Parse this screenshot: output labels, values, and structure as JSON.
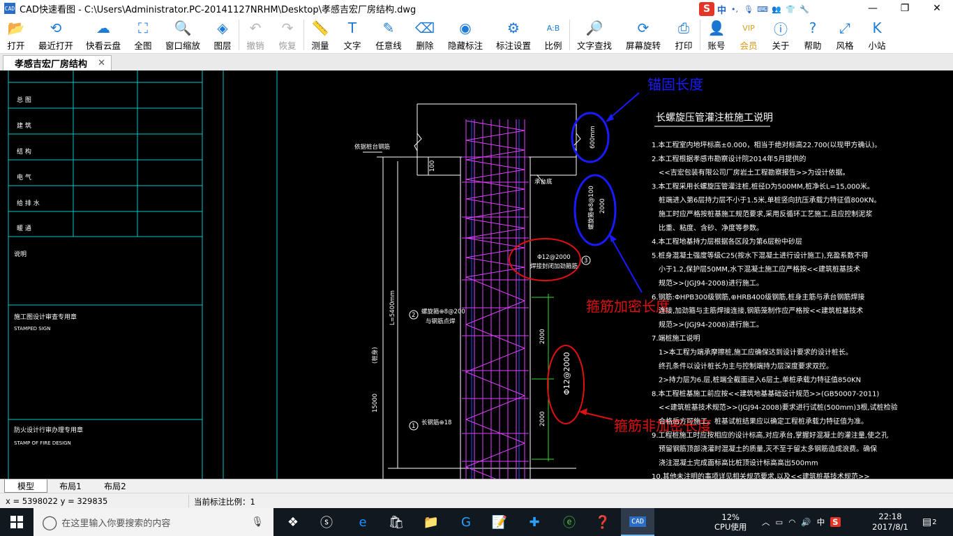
{
  "window": {
    "title": "CAD快速看图 - C:\\Users\\Administrator.PC-20141127NRHM\\Desktop\\孝感吉宏厂房结构.dwg",
    "app_icon": "CAD"
  },
  "ime": {
    "logo": "S",
    "lang": "中",
    "punct": "•,"
  },
  "window_controls": {
    "minimize": "—",
    "maximize": "❐",
    "close": "✕"
  },
  "toolbar": [
    {
      "label": "打开",
      "icon": "folder-open-icon",
      "glyph": "📂",
      "disabled": false
    },
    {
      "label": "最近打开",
      "icon": "history-icon",
      "glyph": "⟲",
      "disabled": false
    },
    {
      "label": "快看云盘",
      "icon": "cloud-icon",
      "glyph": "☁",
      "disabled": false
    },
    {
      "label": "全图",
      "icon": "fit-all-icon",
      "glyph": "⛶",
      "disabled": false
    },
    {
      "label": "窗口缩放",
      "icon": "zoom-window-icon",
      "glyph": "🔍",
      "disabled": false
    },
    {
      "label": "图层",
      "icon": "layers-icon",
      "glyph": "◈",
      "disabled": false
    },
    {
      "label": "撤销",
      "icon": "undo-icon",
      "glyph": "↶",
      "disabled": true
    },
    {
      "label": "恢复",
      "icon": "redo-icon",
      "glyph": "↷",
      "disabled": true
    },
    {
      "label": "测量",
      "icon": "ruler-icon",
      "glyph": "📏",
      "disabled": false
    },
    {
      "label": "文字",
      "icon": "text-icon",
      "glyph": "T",
      "disabled": false
    },
    {
      "label": "任意线",
      "icon": "pencil-icon",
      "glyph": "✎",
      "disabled": false
    },
    {
      "label": "删除",
      "icon": "eraser-icon",
      "glyph": "⌫",
      "disabled": false
    },
    {
      "label": "隐藏标注",
      "icon": "eye-hide-icon",
      "glyph": "◉",
      "disabled": false
    },
    {
      "label": "标注设置",
      "icon": "settings-icon",
      "glyph": "⚙",
      "disabled": false
    },
    {
      "label": "比例",
      "icon": "scale-icon",
      "glyph": "A:B",
      "disabled": false
    },
    {
      "label": "文字查找",
      "icon": "text-search-icon",
      "glyph": "🔎",
      "disabled": false
    },
    {
      "label": "屏幕旋转",
      "icon": "rotate-icon",
      "glyph": "⟳",
      "disabled": false
    },
    {
      "label": "打印",
      "icon": "printer-icon",
      "glyph": "⎙",
      "disabled": false
    },
    {
      "label": "账号",
      "icon": "user-icon",
      "glyph": "👤",
      "disabled": false
    },
    {
      "label": "会员",
      "icon": "vip-icon",
      "glyph": "VIP",
      "disabled": false
    },
    {
      "label": "关于",
      "icon": "info-icon",
      "glyph": "ⓘ",
      "disabled": false
    },
    {
      "label": "帮助",
      "icon": "help-icon",
      "glyph": "?",
      "disabled": false
    },
    {
      "label": "风格",
      "icon": "style-icon",
      "glyph": "⤢",
      "disabled": false
    },
    {
      "label": "小站",
      "icon": "site-icon",
      "glyph": "K",
      "disabled": false
    }
  ],
  "doc_tab": {
    "label": "孝感吉宏厂房结构",
    "close": "✕"
  },
  "drawing": {
    "title_block": {
      "rows": [
        "总  图",
        "建  筑",
        "结  构",
        "电  气",
        "给 排 水",
        "暖  通"
      ],
      "note_label": "说明",
      "stamp_cn": "施工图设计审查专用章",
      "stamp_en": "STAMPED SIGN",
      "fire_cn": "防火设计行审办理专用章",
      "fire_en": "STAMP OF FIRE DESIGN"
    },
    "annotations": {
      "anchor": "锚固长度",
      "dense": "箍筋加密长度",
      "non_dense": "箍筋非加密长度"
    },
    "section_labels": {
      "pile_top": "依据桩台钢筋",
      "cap_bottom": "承台底",
      "dim_600": "600mm",
      "dim_100": "100",
      "spiral_dense": "螺旋箍⊕8@100",
      "dim_2000a": "2000",
      "ring_bar": "Φ12@2000",
      "ring_desc": "焊接封闭加劲箍筋",
      "c3": "3",
      "pile_len": "L=5400mm",
      "c2": "2",
      "spiral2": "螺旋箍⊕8@200",
      "spiral2_desc": "与钢筋点焊",
      "bar_desc": "(桩身)",
      "dim_2000b": "2000",
      "ring_bar2": "Φ12@2000",
      "dim_2000c": "2000",
      "dim_15000": "15000",
      "c1": "1",
      "main_bar": "长钢筋⊕18"
    },
    "spec_title": "长螺旋压管灌注桩施工说明",
    "spec_lines": [
      "1.本工程室内地坪标高±0.000，相当于绝对标高22.700(以现甲方确认)。",
      "2.本工程根据孝感市勘察设计院2014年5月提供的",
      "  <<吉宏包装有限公司厂房岩土工程勘察报告>>为设计依据。",
      "3.本工程采用长螺旋压管灌注桩,桩径D为500MM,桩净长L=15,000米。",
      "  桩端进入第6层持力层不小于1.5米,单桩竖向抗压承载力特征值800KN。",
      "  施工时应严格按桩基施工规范要求,采用反循环工艺施工,且应控制泥浆",
      "  比重、粘度、含砂、净度等参数。",
      "4.本工程地基持力层根据各区段为第6层粉中砂层",
      "5.桩身混凝土强度等级C25(按水下混凝土进行设计施工),充盈系数不得",
      "  小于1.2,保护层50MM,水下混凝土施工应严格按<<建筑桩基技术",
      "  规范>>(JGJ94-2008)进行施工。",
      "6.钢筋:ΦHPB300级钢筋,⊕HRB400级钢筋,桩身主筋与承台钢筋焊接",
      "  连接,加劲箍与主筋焊接连接,钢筋笼制作应严格按<<建筑桩基技术",
      "  规范>>(JGJ94-2008)进行施工。",
      "7.端桩施工说明",
      "  1>本工程为端承摩擦桩,施工应确保达到设计要求的设计桩长。",
      "    终孔条件以设计桩长为主与控制端持力层深度要求双控。",
      "  2>持力层为6.层,桩端全截面进入6层土,单桩承载力特征值850KN",
      "8.本工程桩基施工前应按<<建筑地基基础设计规范>>(GB50007-2011)",
      "  <<建筑桩基技术规范>>(JGJ94-2008)要求进行试桩(500mm)3根,试桩检验",
      "  合格后方可施工。桩基试桩结果应以确定工程桩承载力特征值为准。",
      "9.工程桩施工时应按相应的设计标高,对应承台,掌握好混凝土的灌注量,使之孔",
      "  预留钢筋顶部浇灌时混凝土的质量,灭不至于留太多钢筋造成浪费。确保",
      "  浇注混凝土完成面标高比桩顶设计标高高出500mm",
      "10.其他未注明的事项详见相关规范要求,以及<<建筑桩基技术规范>>"
    ]
  },
  "layout_tabs": [
    "模型",
    "布局1",
    "布局2"
  ],
  "status": {
    "coords": "x = 5398022  y = 329835",
    "scale": "当前标注比例：1"
  },
  "taskbar": {
    "search_placeholder": "在这里输入你要搜索的内容",
    "cpu_percent": "12%",
    "cpu_label": "CPU使用",
    "ime_lang": "中",
    "time": "22:18",
    "date": "2017/8/1",
    "notifications": "2"
  }
}
